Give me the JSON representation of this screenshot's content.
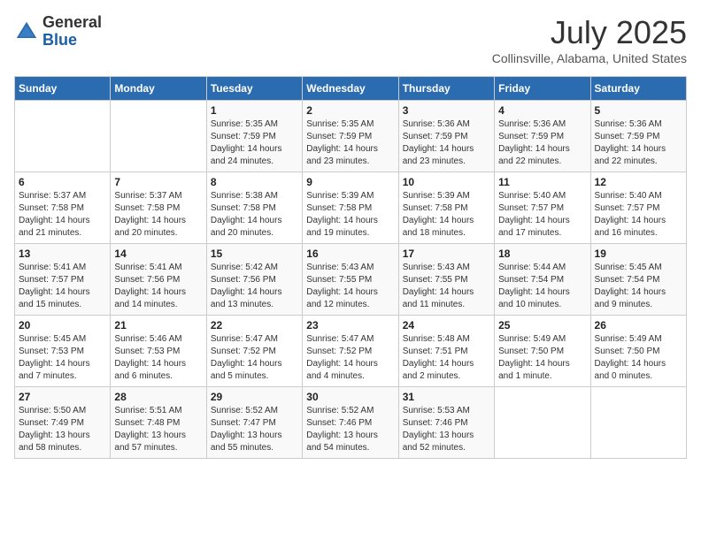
{
  "header": {
    "logo_general": "General",
    "logo_blue": "Blue",
    "month_year": "July 2025",
    "location": "Collinsville, Alabama, United States"
  },
  "weekdays": [
    "Sunday",
    "Monday",
    "Tuesday",
    "Wednesday",
    "Thursday",
    "Friday",
    "Saturday"
  ],
  "weeks": [
    [
      {
        "day": "",
        "sunrise": "",
        "sunset": "",
        "daylight": ""
      },
      {
        "day": "",
        "sunrise": "",
        "sunset": "",
        "daylight": ""
      },
      {
        "day": "1",
        "sunrise": "Sunrise: 5:35 AM",
        "sunset": "Sunset: 7:59 PM",
        "daylight": "Daylight: 14 hours and 24 minutes."
      },
      {
        "day": "2",
        "sunrise": "Sunrise: 5:35 AM",
        "sunset": "Sunset: 7:59 PM",
        "daylight": "Daylight: 14 hours and 23 minutes."
      },
      {
        "day": "3",
        "sunrise": "Sunrise: 5:36 AM",
        "sunset": "Sunset: 7:59 PM",
        "daylight": "Daylight: 14 hours and 23 minutes."
      },
      {
        "day": "4",
        "sunrise": "Sunrise: 5:36 AM",
        "sunset": "Sunset: 7:59 PM",
        "daylight": "Daylight: 14 hours and 22 minutes."
      },
      {
        "day": "5",
        "sunrise": "Sunrise: 5:36 AM",
        "sunset": "Sunset: 7:59 PM",
        "daylight": "Daylight: 14 hours and 22 minutes."
      }
    ],
    [
      {
        "day": "6",
        "sunrise": "Sunrise: 5:37 AM",
        "sunset": "Sunset: 7:58 PM",
        "daylight": "Daylight: 14 hours and 21 minutes."
      },
      {
        "day": "7",
        "sunrise": "Sunrise: 5:37 AM",
        "sunset": "Sunset: 7:58 PM",
        "daylight": "Daylight: 14 hours and 20 minutes."
      },
      {
        "day": "8",
        "sunrise": "Sunrise: 5:38 AM",
        "sunset": "Sunset: 7:58 PM",
        "daylight": "Daylight: 14 hours and 20 minutes."
      },
      {
        "day": "9",
        "sunrise": "Sunrise: 5:39 AM",
        "sunset": "Sunset: 7:58 PM",
        "daylight": "Daylight: 14 hours and 19 minutes."
      },
      {
        "day": "10",
        "sunrise": "Sunrise: 5:39 AM",
        "sunset": "Sunset: 7:58 PM",
        "daylight": "Daylight: 14 hours and 18 minutes."
      },
      {
        "day": "11",
        "sunrise": "Sunrise: 5:40 AM",
        "sunset": "Sunset: 7:57 PM",
        "daylight": "Daylight: 14 hours and 17 minutes."
      },
      {
        "day": "12",
        "sunrise": "Sunrise: 5:40 AM",
        "sunset": "Sunset: 7:57 PM",
        "daylight": "Daylight: 14 hours and 16 minutes."
      }
    ],
    [
      {
        "day": "13",
        "sunrise": "Sunrise: 5:41 AM",
        "sunset": "Sunset: 7:57 PM",
        "daylight": "Daylight: 14 hours and 15 minutes."
      },
      {
        "day": "14",
        "sunrise": "Sunrise: 5:41 AM",
        "sunset": "Sunset: 7:56 PM",
        "daylight": "Daylight: 14 hours and 14 minutes."
      },
      {
        "day": "15",
        "sunrise": "Sunrise: 5:42 AM",
        "sunset": "Sunset: 7:56 PM",
        "daylight": "Daylight: 14 hours and 13 minutes."
      },
      {
        "day": "16",
        "sunrise": "Sunrise: 5:43 AM",
        "sunset": "Sunset: 7:55 PM",
        "daylight": "Daylight: 14 hours and 12 minutes."
      },
      {
        "day": "17",
        "sunrise": "Sunrise: 5:43 AM",
        "sunset": "Sunset: 7:55 PM",
        "daylight": "Daylight: 14 hours and 11 minutes."
      },
      {
        "day": "18",
        "sunrise": "Sunrise: 5:44 AM",
        "sunset": "Sunset: 7:54 PM",
        "daylight": "Daylight: 14 hours and 10 minutes."
      },
      {
        "day": "19",
        "sunrise": "Sunrise: 5:45 AM",
        "sunset": "Sunset: 7:54 PM",
        "daylight": "Daylight: 14 hours and 9 minutes."
      }
    ],
    [
      {
        "day": "20",
        "sunrise": "Sunrise: 5:45 AM",
        "sunset": "Sunset: 7:53 PM",
        "daylight": "Daylight: 14 hours and 7 minutes."
      },
      {
        "day": "21",
        "sunrise": "Sunrise: 5:46 AM",
        "sunset": "Sunset: 7:53 PM",
        "daylight": "Daylight: 14 hours and 6 minutes."
      },
      {
        "day": "22",
        "sunrise": "Sunrise: 5:47 AM",
        "sunset": "Sunset: 7:52 PM",
        "daylight": "Daylight: 14 hours and 5 minutes."
      },
      {
        "day": "23",
        "sunrise": "Sunrise: 5:47 AM",
        "sunset": "Sunset: 7:52 PM",
        "daylight": "Daylight: 14 hours and 4 minutes."
      },
      {
        "day": "24",
        "sunrise": "Sunrise: 5:48 AM",
        "sunset": "Sunset: 7:51 PM",
        "daylight": "Daylight: 14 hours and 2 minutes."
      },
      {
        "day": "25",
        "sunrise": "Sunrise: 5:49 AM",
        "sunset": "Sunset: 7:50 PM",
        "daylight": "Daylight: 14 hours and 1 minute."
      },
      {
        "day": "26",
        "sunrise": "Sunrise: 5:49 AM",
        "sunset": "Sunset: 7:50 PM",
        "daylight": "Daylight: 14 hours and 0 minutes."
      }
    ],
    [
      {
        "day": "27",
        "sunrise": "Sunrise: 5:50 AM",
        "sunset": "Sunset: 7:49 PM",
        "daylight": "Daylight: 13 hours and 58 minutes."
      },
      {
        "day": "28",
        "sunrise": "Sunrise: 5:51 AM",
        "sunset": "Sunset: 7:48 PM",
        "daylight": "Daylight: 13 hours and 57 minutes."
      },
      {
        "day": "29",
        "sunrise": "Sunrise: 5:52 AM",
        "sunset": "Sunset: 7:47 PM",
        "daylight": "Daylight: 13 hours and 55 minutes."
      },
      {
        "day": "30",
        "sunrise": "Sunrise: 5:52 AM",
        "sunset": "Sunset: 7:46 PM",
        "daylight": "Daylight: 13 hours and 54 minutes."
      },
      {
        "day": "31",
        "sunrise": "Sunrise: 5:53 AM",
        "sunset": "Sunset: 7:46 PM",
        "daylight": "Daylight: 13 hours and 52 minutes."
      },
      {
        "day": "",
        "sunrise": "",
        "sunset": "",
        "daylight": ""
      },
      {
        "day": "",
        "sunrise": "",
        "sunset": "",
        "daylight": ""
      }
    ]
  ]
}
